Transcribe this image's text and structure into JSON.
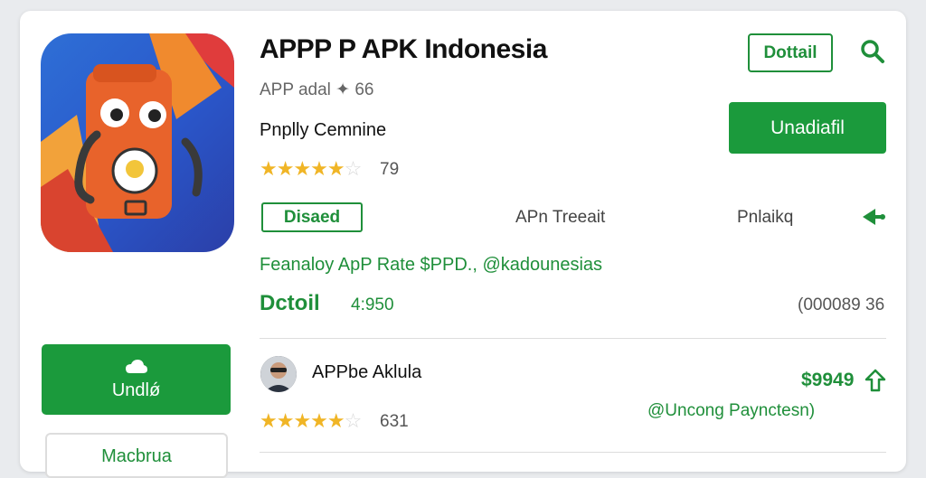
{
  "app": {
    "title": "APPP P APK Indonesia",
    "meta": "APP adal ✦ 66",
    "developer": "Pnplly Cemnine",
    "rating_stars": 4.5,
    "rating_count": "79"
  },
  "actions": {
    "detail_label": "Dottail",
    "install_label": "Unadiafil",
    "badge_label": "Disaed",
    "tabs": [
      "APn Treeait",
      "Pnlaikq"
    ]
  },
  "promo_text": "Feanaloy ApP Rate $PPD., @kadounesias",
  "download": {
    "label": "Dctoil",
    "size": "4:950",
    "code": "(000089 36"
  },
  "left_panel": {
    "install_label": "Undlǿ",
    "secondary_label": "Macbrua"
  },
  "review": {
    "name": "APPbe Aklula",
    "rating_stars": 4.5,
    "rating_count": "631",
    "price": "$9949",
    "note": "@Uncong Paynctesn)"
  },
  "icons": {
    "search": "search-icon",
    "share": "share-icon",
    "upvote": "upvote-icon",
    "download": "download-icon"
  },
  "colors": {
    "brand_green": "#1b9a3c",
    "star": "#f0b526",
    "icon_orange": "#e8632b"
  }
}
